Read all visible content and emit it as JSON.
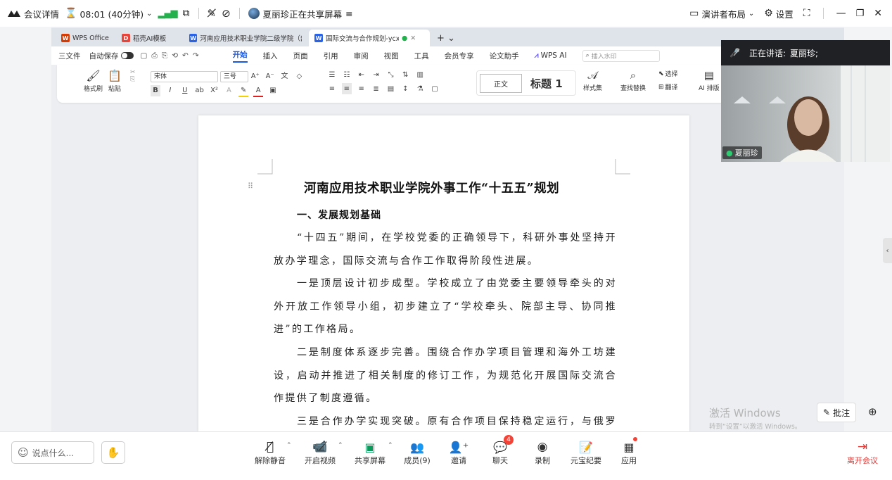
{
  "topbar": {
    "meeting_details": "会议详情",
    "timer": "08:01 (40分钟)",
    "sharing_status": "夏丽珍正在共享屏幕",
    "presenter_layout": "演讲者布局",
    "settings": "设置"
  },
  "wps": {
    "tabs": [
      {
        "label": "WPS Office",
        "color": "#d83b01",
        "logo": "W"
      },
      {
        "label": "稻壳AI模板",
        "color": "#e8443a",
        "logo": "D"
      },
      {
        "label": "河南应用技术职业学院二级学院（部",
        "color": "#2b63e6",
        "logo": "W"
      },
      {
        "label": "国际交流与合作规划-ycx.doc",
        "color": "#2b63e6",
        "logo": "W"
      }
    ],
    "menu": [
      "三文件",
      "自动保存",
      "开始",
      "插入",
      "页面",
      "引用",
      "审阅",
      "视图",
      "工具",
      "会员专享",
      "论文助手",
      "WPS AI"
    ],
    "search_placeholder": "插入水印",
    "ribbon": {
      "format_painter": "格式刷",
      "paste": "粘贴",
      "font_name": "宋体",
      "font_size": "三号",
      "style_normal": "正文",
      "style_heading": "标题 1",
      "style_set": "样式集",
      "find_replace": "查找替换",
      "select": "选择",
      "translate": "翻译",
      "ai_layout": "AI 排版"
    }
  },
  "document": {
    "title": "河南应用技术职业学院外事工作“十五五”规划",
    "heading1": "一、发展规划基础",
    "paragraphs": [
      "“十四五”期间，在学校党委的正确领导下，科研外事处坚持开放办学理念，国际交流与合作工作取得阶段性进展。",
      "一是顶层设计初步成型。学校成立了由党委主要领导牵头的对外开放工作领导小组，初步建立了“学校牵头、院部主导、协同推进”的工作格局。",
      "二是制度体系逐步完善。围绕合作办学项目管理和海外工坊建设，启动并推进了相关制度的修订工作，为规范化开展国际交流合作提供了制度遵循。",
      "三是合作办学实现突破。原有合作项目保持稳定运行，与俄罗斯"
    ]
  },
  "video": {
    "speaking_label": "正在讲话:",
    "speaker": "夏丽珍;",
    "name_tag": "夏丽珍"
  },
  "watermark": {
    "line1": "激活 Windows",
    "line2": "转到“设置”以激活 Windows。"
  },
  "annotate": "批注",
  "bottombar": {
    "say_something": "说点什么...",
    "unmute": "解除静音",
    "start_video": "开启视频",
    "share_screen": "共享屏幕",
    "members": "成员(9)",
    "invite": "邀请",
    "chat": "聊天",
    "chat_badge": "4",
    "record": "录制",
    "yuanbao": "元宝纪要",
    "apps": "应用",
    "leave": "离开会议"
  }
}
